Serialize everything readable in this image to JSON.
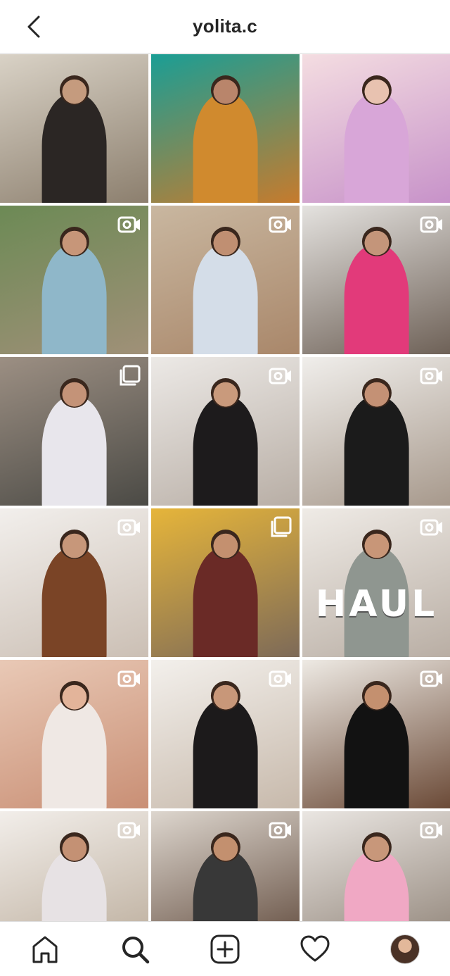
{
  "header": {
    "title": "yolita.c",
    "back_icon": "chevron-left-icon"
  },
  "grid": {
    "tiles": [
      {
        "media": "none",
        "bg": [
          "#d9d2c6",
          "#8c7f6e"
        ],
        "figure": "#2b2624",
        "skin": "#c59b7e"
      },
      {
        "media": "none",
        "bg": [
          "#1a9e95",
          "#c67b2d"
        ],
        "figure": "#d08a2e",
        "skin": "#b9856b"
      },
      {
        "media": "none",
        "bg": [
          "#f4dde1",
          "#c792c9"
        ],
        "figure": "#d8a6d8",
        "skin": "#e8c2b0"
      },
      {
        "media": "video",
        "bg": [
          "#6c8a55",
          "#a09078"
        ],
        "figure": "#8fb7c9",
        "skin": "#c79679"
      },
      {
        "media": "video",
        "bg": [
          "#c9b7a0",
          "#a9876a"
        ],
        "figure": "#d4dde8",
        "skin": "#c08f72"
      },
      {
        "media": "video",
        "bg": [
          "#e4e2df",
          "#6e6157"
        ],
        "figure": "#e23a7a",
        "skin": "#c4957a"
      },
      {
        "media": "album",
        "bg": [
          "#9c8f83",
          "#4b4a45"
        ],
        "figure": "#e8e6ec",
        "skin": "#c49378"
      },
      {
        "media": "video",
        "bg": [
          "#ece9e6",
          "#b8aea5"
        ],
        "figure": "#1d1b1c",
        "skin": "#c99a7c"
      },
      {
        "media": "video",
        "bg": [
          "#f0eeeb",
          "#a7998c"
        ],
        "figure": "#1b1b1b",
        "skin": "#c49175"
      },
      {
        "media": "video",
        "bg": [
          "#f2efec",
          "#cbbfb4"
        ],
        "figure": "#7a4426",
        "skin": "#c7977a"
      },
      {
        "media": "album",
        "bg": [
          "#e6b53a",
          "#7d6a58"
        ],
        "figure": "#6a2a26",
        "skin": "#c4906f"
      },
      {
        "media": "video",
        "bg": [
          "#efebe6",
          "#b9aea4"
        ],
        "figure": "#8f9690",
        "skin": "#c89678",
        "overlay_text": "HAUL"
      },
      {
        "media": "video",
        "bg": [
          "#e9c9b6",
          "#c98f75"
        ],
        "figure": "#efe8e4",
        "skin": "#e3b49a"
      },
      {
        "media": "video",
        "bg": [
          "#f3f0ec",
          "#c7b9ab"
        ],
        "figure": "#1c1a1b",
        "skin": "#c89779"
      },
      {
        "media": "video",
        "bg": [
          "#eeeae4",
          "#6b4a37"
        ],
        "figure": "#121212",
        "skin": "#c4906f"
      },
      {
        "media": "video",
        "bg": [
          "#f2eeea",
          "#b9aa98"
        ],
        "figure": "#e7e2e4",
        "skin": "#c49174"
      },
      {
        "media": "video",
        "bg": [
          "#ddd6ce",
          "#5b4436"
        ],
        "figure": "#383838",
        "skin": "#c3906f"
      },
      {
        "media": "video",
        "bg": [
          "#eae6e2",
          "#8b7e72"
        ],
        "figure": "#f0a8c4",
        "skin": "#c8977a"
      }
    ]
  },
  "tabbar": {
    "items": [
      {
        "name": "home",
        "icon": "home-icon"
      },
      {
        "name": "search",
        "icon": "search-icon",
        "active": true
      },
      {
        "name": "new-post",
        "icon": "add-post-icon"
      },
      {
        "name": "activity",
        "icon": "heart-icon"
      },
      {
        "name": "profile",
        "icon": "avatar"
      }
    ]
  }
}
